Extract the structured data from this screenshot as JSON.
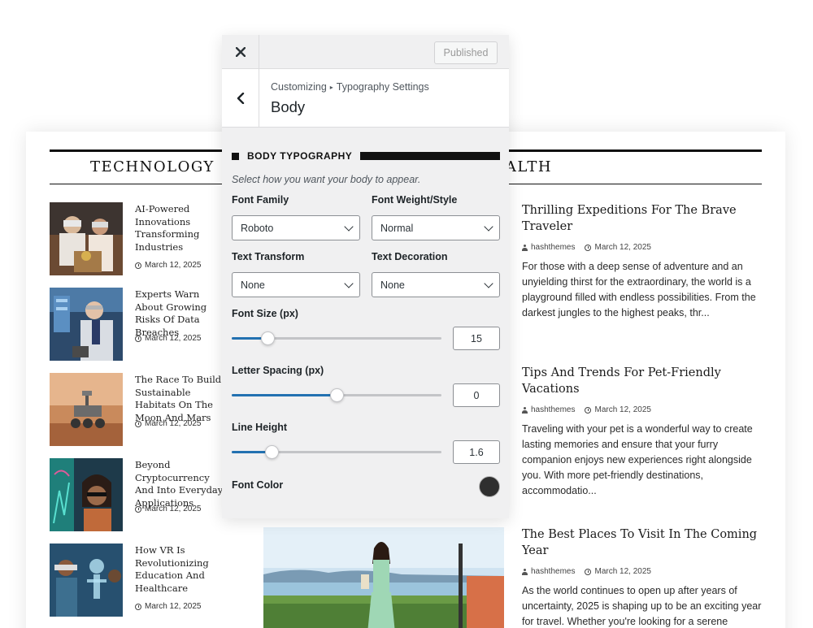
{
  "blog": {
    "left_section": "TECHNOLOGY",
    "right_section": "HEALTH",
    "tech_posts": [
      {
        "title": "AI-Powered Innovations Transforming Industries",
        "date": "March 12, 2025"
      },
      {
        "title": "Experts Warn About Growing Risks Of Data Breaches",
        "date": "March 12, 2025"
      },
      {
        "title": "The Race To Build Sustainable Habitats On The Moon And Mars",
        "date": "March 12, 2025"
      },
      {
        "title": "Beyond Cryptocurrency And Into Everyday Applications",
        "date": "March 12, 2025"
      },
      {
        "title": "How VR Is Revolutionizing Education And Healthcare",
        "date": "March 12, 2025"
      }
    ],
    "travel_posts": [
      {
        "title": "Thrilling Expeditions For The Brave Traveler",
        "author": "hashthemes",
        "date": "March 12, 2025",
        "excerpt": "For those with a deep sense of adventure and an unyielding thirst for the extraordinary, the world is a playground filled with endless possibilities. From the darkest jungles to the highest peaks, thr..."
      },
      {
        "title": "Tips And Trends For Pet-Friendly Vacations",
        "author": "hashthemes",
        "date": "March 12, 2025",
        "excerpt": "Traveling with your pet is a wonderful way to create lasting memories and ensure that your furry companion enjoys new experiences right alongside you. With more pet-friendly destinations, accommodatio..."
      },
      {
        "title": "The Best Places To Visit In The Coming Year",
        "author": "hashthemes",
        "date": "March 12, 2025",
        "excerpt": "As the world continues to open up after years of uncertainty, 2025 is shaping up to be an exciting year for travel. Whether you're looking for a serene"
      }
    ]
  },
  "customizer": {
    "close_icon": "close-icon",
    "publish_label": "Published",
    "breadcrumb_root": "Customizing",
    "breadcrumb_sep": "▸",
    "breadcrumb_section": "Typography Settings",
    "section_title": "Body",
    "heading": "BODY TYPOGRAPHY",
    "description": "Select how you want your body to appear.",
    "font_family": {
      "label": "Font Family",
      "value": "Roboto"
    },
    "font_weight": {
      "label": "Font Weight/Style",
      "value": "Normal"
    },
    "text_transform": {
      "label": "Text Transform",
      "value": "None"
    },
    "text_decoration": {
      "label": "Text Decoration",
      "value": "None"
    },
    "font_size": {
      "label": "Font Size (px)",
      "value": "15",
      "fraction": 0.17
    },
    "letter_spacing": {
      "label": "Letter Spacing (px)",
      "value": "0",
      "fraction": 0.5
    },
    "line_height": {
      "label": "Line Height",
      "value": "1.6",
      "fraction": 0.19
    },
    "font_color": {
      "label": "Font Color",
      "value": "#2f2f2f"
    },
    "accent_color": "#2271b1"
  }
}
